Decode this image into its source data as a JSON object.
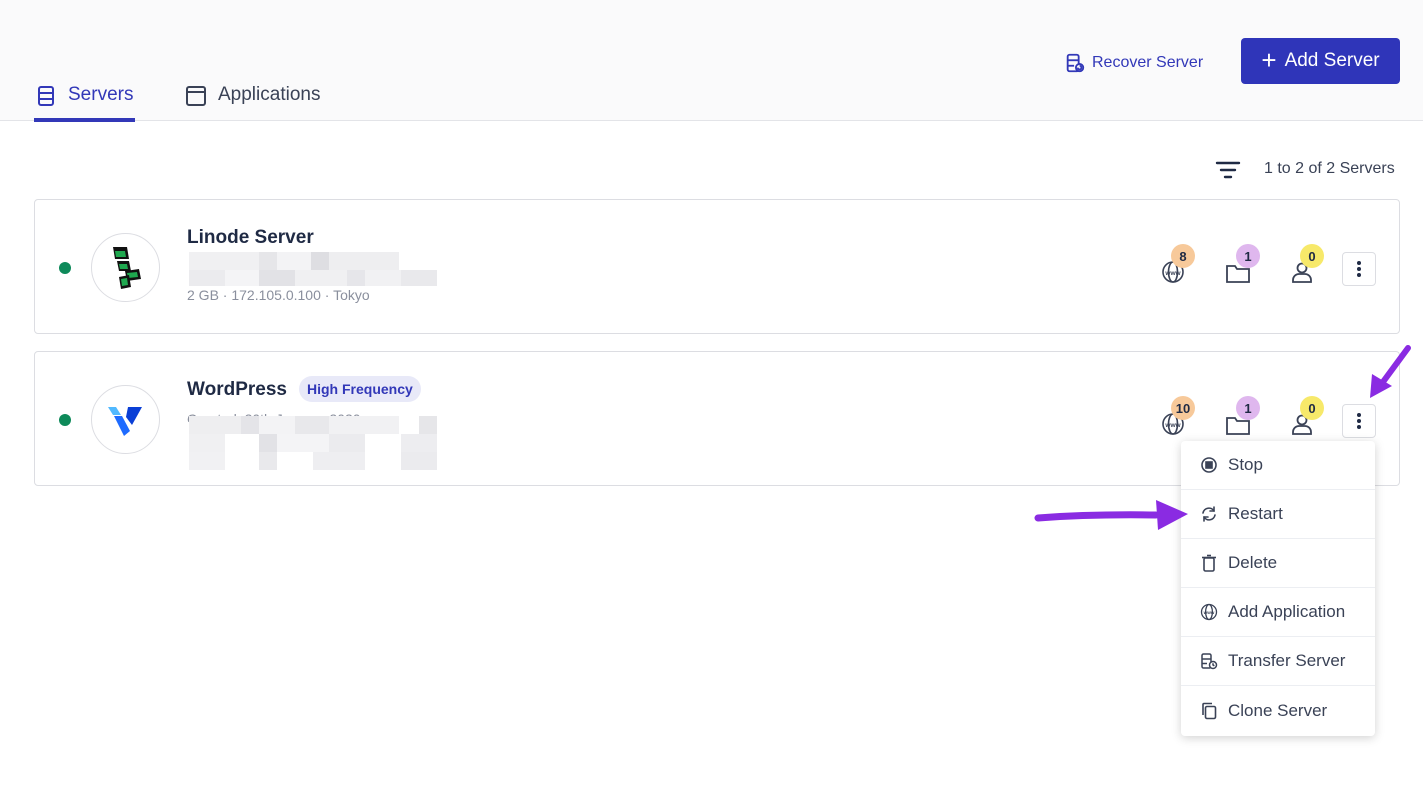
{
  "header": {
    "tabs": [
      {
        "label": "Servers",
        "icon": "server-icon",
        "active": true
      },
      {
        "label": "Applications",
        "icon": "window-icon",
        "active": false
      }
    ],
    "recover_label": "Recover Server",
    "add_label": "Add Server",
    "accent_color": "#2f35b9"
  },
  "toolbar": {
    "count_text": "1 to 2 of 2 Servers"
  },
  "servers": [
    {
      "name": "Linode Server",
      "badge": "",
      "status": "running",
      "status_color": "#0e8a5a",
      "logo": "linode-logo",
      "meta_text": "2 GB · 172.105.0.100 · Tokyo",
      "stats": {
        "websites": "8",
        "apps": "1",
        "users": "0"
      }
    },
    {
      "name": "WordPress",
      "badge": "High Frequency",
      "status": "running",
      "status_color": "#0e8a5a",
      "logo": "vultr-logo",
      "meta_text": "Created: 20th January 2020",
      "stats": {
        "websites": "10",
        "apps": "1",
        "users": "0"
      }
    }
  ],
  "context_menu": {
    "items": [
      {
        "label": "Stop",
        "icon": "stop-icon"
      },
      {
        "label": "Restart",
        "icon": "restart-icon"
      },
      {
        "label": "Delete",
        "icon": "trash-icon"
      },
      {
        "label": "Add Application",
        "icon": "www-icon"
      },
      {
        "label": "Transfer Server",
        "icon": "transfer-server-icon"
      },
      {
        "label": "Clone Server",
        "icon": "clone-icon"
      }
    ]
  },
  "annotations": {
    "arrow_color": "#8a2be2"
  }
}
